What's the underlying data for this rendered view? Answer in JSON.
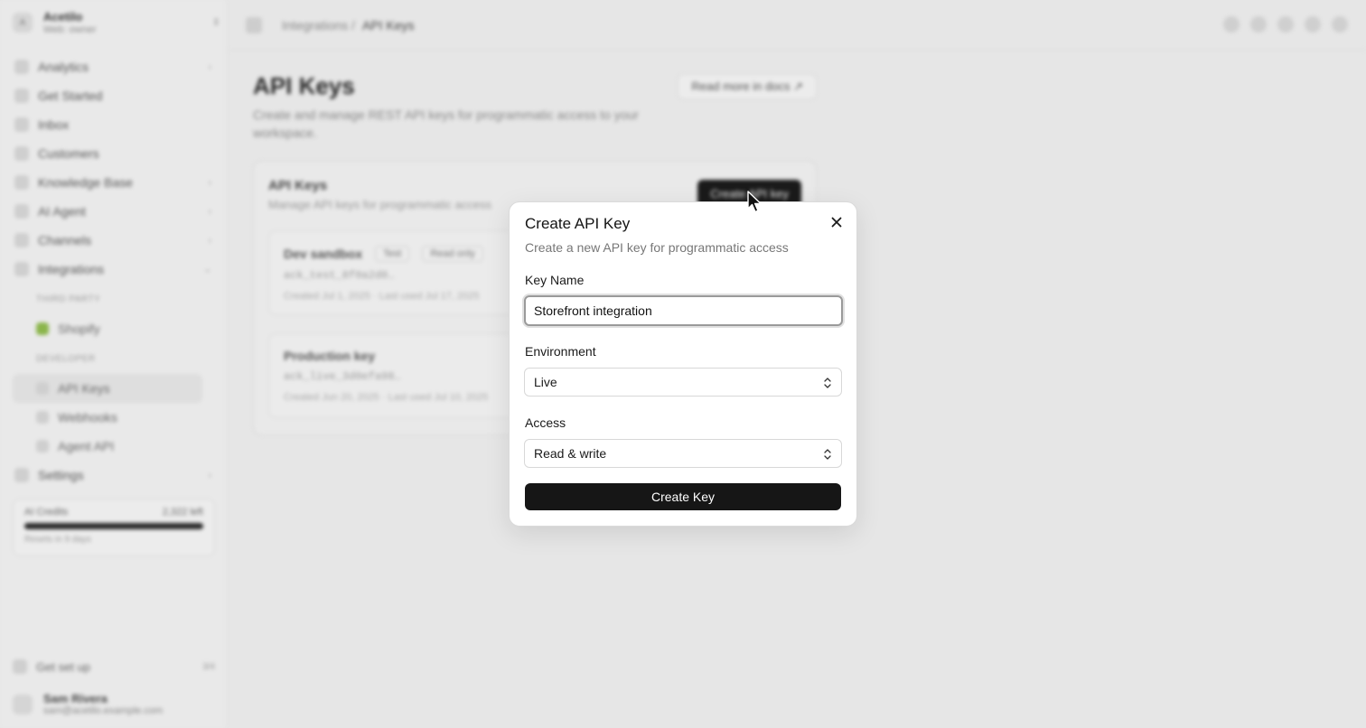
{
  "sidebar": {
    "workspace_initial": "A",
    "workspace_name": "Acetilo",
    "workspace_sub": "Web: owner",
    "toggle_icon": "chevron-updown-icon",
    "items": [
      {
        "label": "Analytics",
        "icon": "chart-icon",
        "chevron": "›"
      },
      {
        "label": "Get Started",
        "icon": "rocket-icon",
        "chevron": ""
      },
      {
        "label": "Inbox",
        "icon": "inbox-icon",
        "chevron": ""
      },
      {
        "label": "Customers",
        "icon": "users-icon",
        "chevron": ""
      },
      {
        "label": "Knowledge Base",
        "icon": "book-icon",
        "chevron": "›"
      },
      {
        "label": "AI Agent",
        "icon": "sparkle-icon",
        "chevron": "›"
      },
      {
        "label": "Channels",
        "icon": "channels-icon",
        "chevron": "›"
      },
      {
        "label": "Integrations",
        "icon": "plug-icon",
        "chevron": "⌄"
      }
    ],
    "group_third_party": "THIRD PARTY",
    "shopify_label": "Shopify",
    "group_developer": "DEVELOPER",
    "api_keys_label": "API Keys",
    "webhooks_label": "Webhooks",
    "agent_api_label": "Agent API",
    "settings_label": "Settings",
    "settings_chevron": "›",
    "credits_label": "AI Credits",
    "credits_value": "2,322 left",
    "credits_note": "Resets in 9 days",
    "get_set_up_label": "Get set up",
    "get_set_up_kbd": "3/4",
    "user_name": "Sam Rivera",
    "user_email": "sam@acetilo.example.com"
  },
  "topbar": {
    "crumb_parent": "Integrations /",
    "crumb_current": "API Keys"
  },
  "page": {
    "title": "API Keys",
    "description": "Create and manage REST API keys for programmatic access to your workspace.",
    "docs_button": "Read more in docs ↗",
    "card_title": "API Keys",
    "card_desc": "Manage API keys for programmatic access",
    "create_button": "Create API key",
    "keys": [
      {
        "name": "Dev sandbox",
        "env": "Test",
        "access": "Read only",
        "token": "ack_test_8f0a2d0…",
        "meta": "Created Jul 1, 2025 · Last used Jul 17, 2025"
      },
      {
        "name": "Production key",
        "env": "",
        "access": "",
        "token": "ack_live_3d0efa98…",
        "meta": "Created Jun 20, 2025 · Last used Jul 10, 2025"
      }
    ]
  },
  "modal": {
    "title": "Create API Key",
    "subtitle": "Create a new API key for programmatic access",
    "key_name_label": "Key Name",
    "key_name_value": "Storefront integration",
    "environment_label": "Environment",
    "environment_value": "Live",
    "access_label": "Access",
    "access_value": "Read & write",
    "submit_label": "Create Key",
    "close_icon": "close-icon"
  },
  "colors": {
    "backdrop": "#e6e6e6",
    "modal_bg": "#ffffff",
    "primary": "#161616",
    "shopify": "#8bb54b"
  }
}
